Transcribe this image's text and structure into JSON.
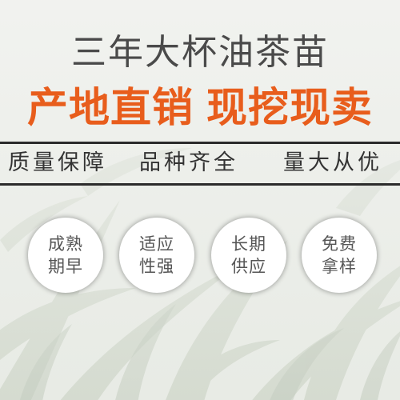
{
  "title": "三年大杯油茶苗",
  "headline": {
    "left": "产地直销",
    "right": "现挖现卖"
  },
  "taglines": [
    "质量保障",
    "品种齐全",
    "量大从优"
  ],
  "badges": [
    {
      "line1": "成熟",
      "line2": "期早"
    },
    {
      "line1": "适应",
      "line2": "性强"
    },
    {
      "line1": "长期",
      "line2": "供应"
    },
    {
      "line1": "免费",
      "line2": "拿样"
    }
  ],
  "colors": {
    "accent": "#e85d1c",
    "text_dark": "#333333",
    "title_gray": "#4a4a4a",
    "badge_text": "#555555",
    "background_leaf": "#c9d2c2"
  }
}
